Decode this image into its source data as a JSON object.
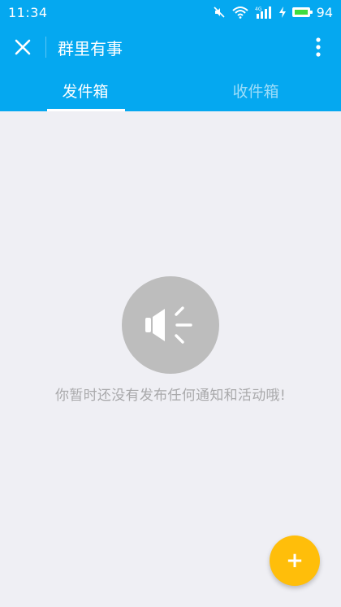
{
  "status_bar": {
    "time": "11:34",
    "network": "4G",
    "battery_percent": "94",
    "icons": [
      "mute-icon",
      "wifi-icon",
      "signal-icon",
      "charging-icon",
      "battery-icon"
    ],
    "battery_color": "#3fdc3f"
  },
  "toolbar": {
    "title": "群里有事",
    "close_icon": "close-icon",
    "more_icon": "more-vertical-icon"
  },
  "tabs": [
    {
      "label": "发件箱",
      "active": true
    },
    {
      "label": "收件箱",
      "active": false
    }
  ],
  "empty_state": {
    "icon": "speaker-icon",
    "message": "你暂时还没有发布任何通知和活动哦!"
  },
  "fab": {
    "label": "+",
    "color": "#ffbe0a"
  },
  "colors": {
    "primary": "#05a8f0",
    "background": "#efeff4"
  }
}
